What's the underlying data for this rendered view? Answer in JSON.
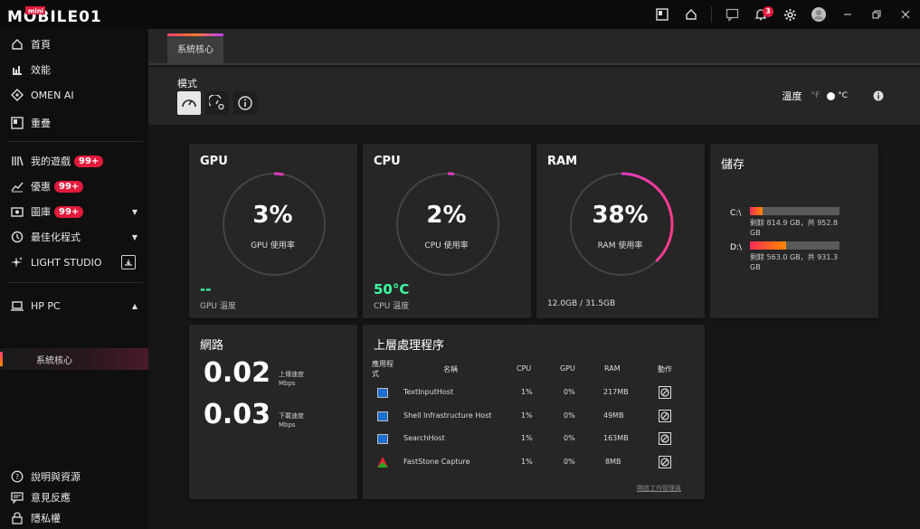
{
  "app": {
    "brand": "MOBILE01",
    "brand_tag": "mini"
  },
  "titlebar": {
    "notif_count": "3"
  },
  "sidebar": {
    "items": [
      {
        "label": "首頁",
        "icon": "home-icon"
      },
      {
        "label": "效能",
        "icon": "performance-icon"
      },
      {
        "label": "OMEN AI",
        "icon": "omen-ai-icon"
      },
      {
        "label": "重疊",
        "icon": "overlay-icon"
      },
      {
        "label": "我的遊戲",
        "icon": "games-icon",
        "badge": "99+"
      },
      {
        "label": "優惠",
        "icon": "deals-icon",
        "badge": "99+"
      },
      {
        "label": "圖庫",
        "icon": "gallery-icon",
        "badge": "99+"
      },
      {
        "label": "最佳化程式",
        "icon": "optimizer-icon"
      },
      {
        "label": "LIGHT STUDIO",
        "icon": "light-studio-icon"
      },
      {
        "label": "HP PC",
        "icon": "pc-icon"
      },
      {
        "label": "系統核心",
        "icon": ""
      },
      {
        "label": "說明與資源",
        "icon": "help-icon"
      },
      {
        "label": "意見反應",
        "icon": "feedback-icon"
      },
      {
        "label": "隱私權",
        "icon": "privacy-icon"
      }
    ]
  },
  "tabs": [
    {
      "label": "系統核心"
    }
  ],
  "mode": {
    "title": "模式",
    "temp_label": "溫度",
    "unit_f": "°F",
    "unit_c": "°C",
    "selected_unit": "°C"
  },
  "gpu": {
    "title": "GPU",
    "value": "3%",
    "value_num": 3,
    "label": "GPU 使用率",
    "temp": "--",
    "temp_label": "GPU 溫度"
  },
  "cpu": {
    "title": "CPU",
    "value": "2%",
    "value_num": 2,
    "label": "CPU 使用率",
    "temp": "50°C",
    "temp_label": "CPU 溫度"
  },
  "ram": {
    "title": "RAM",
    "value": "38%",
    "value_num": 38,
    "label": "RAM 使用率",
    "usage": "12.0GB / 31.5GB"
  },
  "storage": {
    "title": "儲存",
    "drives": [
      {
        "name": "C:\\",
        "used_fraction": 0.14,
        "line1": "剩餘 814.9 GB，共 952.8",
        "line2": "GB"
      },
      {
        "name": "D:\\",
        "used_fraction": 0.4,
        "line1": "剩餘 563.0 GB，共 931.3",
        "line2": "GB"
      }
    ]
  },
  "network": {
    "title": "網路",
    "upload": {
      "value": "0.02",
      "label1": "上傳速度",
      "label2": "Mbps"
    },
    "download": {
      "value": "0.03",
      "label1": "下載速度",
      "label2": "Mbps"
    }
  },
  "processes": {
    "title": "上層處理程序",
    "headers": {
      "app1": "應用程",
      "app2": "式",
      "name": "名稱",
      "cpu": "CPU",
      "gpu": "GPU",
      "ram": "RAM",
      "action": "動作"
    },
    "rows": [
      {
        "name": "TextInputHost",
        "cpu": "1%",
        "gpu": "0%",
        "ram": "217MB"
      },
      {
        "name": "Shell Infrastructure Host",
        "cpu": "1%",
        "gpu": "0%",
        "ram": "49MB"
      },
      {
        "name": "SearchHost",
        "cpu": "1%",
        "gpu": "0%",
        "ram": "163MB"
      },
      {
        "name": "FastStone Capture",
        "cpu": "1%",
        "gpu": "0%",
        "ram": "8MB"
      }
    ],
    "task_manager_link": "開啟工作管理員"
  },
  "colors": {
    "accent_pink": "#ff3b6b",
    "accent_purple": "#c23bff",
    "accent_orange": "#ff8a00",
    "cpu_temp": "#3dffa0",
    "badge": "#e21b3c"
  }
}
